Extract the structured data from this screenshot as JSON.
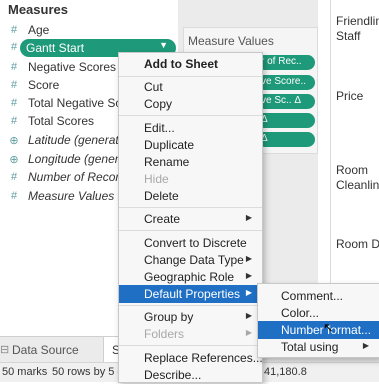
{
  "data_pane": {
    "title": "Measures",
    "fields": [
      {
        "label": "Age",
        "icon": "#"
      },
      {
        "label": "Gantt Start",
        "icon": "#"
      },
      {
        "label": "Negative Scores",
        "icon": "#"
      },
      {
        "label": "Score",
        "icon": "#"
      },
      {
        "label": "Total Negative Sco",
        "icon": "#"
      },
      {
        "label": "Total Scores",
        "icon": "#"
      },
      {
        "label": "Latitude (generate",
        "icon": "⊕"
      },
      {
        "label": "Longitude (genera",
        "icon": "⊕"
      },
      {
        "label": "Number of Record",
        "icon": "#"
      },
      {
        "label": "Measure Values",
        "icon": "#"
      }
    ]
  },
  "marks_card": {
    "title": "Measure Values",
    "pills": [
      "r of Rec..",
      "ve Score..",
      "ve Sc.. Δ",
      "Δ",
      "Δ"
    ]
  },
  "right_labels": [
    "Friendlin",
    "Staff",
    "Price",
    "Room",
    "Cleanline",
    "Room De"
  ],
  "context_menu": {
    "items": [
      {
        "label": "Add to Sheet",
        "bold": true
      },
      {
        "label": "Cut"
      },
      {
        "label": "Copy"
      },
      {
        "label": "Edit..."
      },
      {
        "label": "Duplicate"
      },
      {
        "label": "Rename"
      },
      {
        "label": "Hide",
        "disabled": true
      },
      {
        "label": "Delete"
      },
      {
        "label": "Create",
        "submenu": true
      },
      {
        "label": "Convert to Discrete"
      },
      {
        "label": "Change Data Type",
        "submenu": true
      },
      {
        "label": "Geographic Role",
        "submenu": true
      },
      {
        "label": "Default Properties",
        "submenu": true,
        "highlighted": true
      },
      {
        "label": "Group by",
        "submenu": true
      },
      {
        "label": "Folders",
        "submenu": true,
        "disabled": true
      },
      {
        "label": "Replace References..."
      },
      {
        "label": "Describe..."
      }
    ]
  },
  "sub_menu": {
    "items": [
      {
        "label": "Comment..."
      },
      {
        "label": "Color..."
      },
      {
        "label": "Number format...",
        "highlighted": true
      },
      {
        "label": "Total using",
        "submenu": true
      }
    ]
  },
  "tabs": {
    "data_source": "Data Source",
    "sheet": "S"
  },
  "status": {
    "marks": "50 marks",
    "rows_cols": "50 rows by 5 co",
    "sum": "41,180.8"
  },
  "colors": {
    "accent_green": "#1e9a7a",
    "menu_highlight": "#1f6fc5"
  }
}
